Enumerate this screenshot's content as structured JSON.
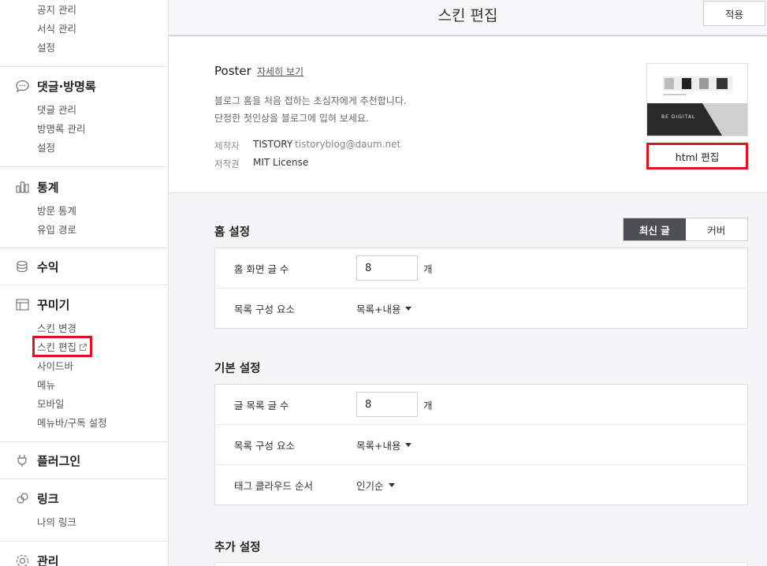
{
  "sidebar": {
    "top_items": [
      "공지 관리",
      "서식 관리",
      "설정"
    ],
    "comments": {
      "title": "댓글·방명록",
      "items": [
        "댓글 관리",
        "방명록 관리",
        "설정"
      ]
    },
    "stats": {
      "title": "통계",
      "items": [
        "방문 통계",
        "유입 경로"
      ]
    },
    "revenue": {
      "title": "수익"
    },
    "decorate": {
      "title": "꾸미기",
      "items": [
        "스킨 변경",
        "스킨 편집",
        "사이드바",
        "메뉴",
        "모바일",
        "메뉴바/구독 설정"
      ]
    },
    "plugin": {
      "title": "플러그인"
    },
    "link": {
      "title": "링크",
      "items": [
        "나의 링크"
      ]
    },
    "manage": {
      "title": "관리"
    }
  },
  "header": {
    "title": "스킨 편집",
    "apply_label": "적용"
  },
  "skin": {
    "name": "Poster",
    "more_label": "자세히 보기",
    "desc_line1": "블로그 홈을 처음 접하는 초심자에게 추천합니다.",
    "desc_line2": "단정한 첫인상을 블로그에 입혀 보세요.",
    "maker_label": "제작자",
    "maker_value": "TISTORY",
    "maker_email": "tistoryblog@daum.net",
    "license_label": "저작권",
    "license_value": "MIT License",
    "thumb_caption": "BE DIGITAL",
    "html_edit_label": "html 편집"
  },
  "home_settings": {
    "title": "홈 설정",
    "tabs": [
      "최신 글",
      "커버"
    ],
    "active_tab": "최신 글",
    "rows": {
      "count_label": "홈 화면 글 수",
      "count_value": "8",
      "unit": "개",
      "composition_label": "목록 구성 요소",
      "composition_value": "목록+내용"
    }
  },
  "basic_settings": {
    "title": "기본 설정",
    "rows": {
      "count_label": "글 목록 글 수",
      "count_value": "8",
      "unit": "개",
      "composition_label": "목록 구성 요소",
      "composition_value": "목록+내용",
      "tag_label": "태그 클라우드 순서",
      "tag_value": "인기순"
    }
  },
  "extra_settings": {
    "title": "추가 설정"
  },
  "colors": {
    "highlight": "#e0141e",
    "active_tab": "#4d4f55"
  }
}
